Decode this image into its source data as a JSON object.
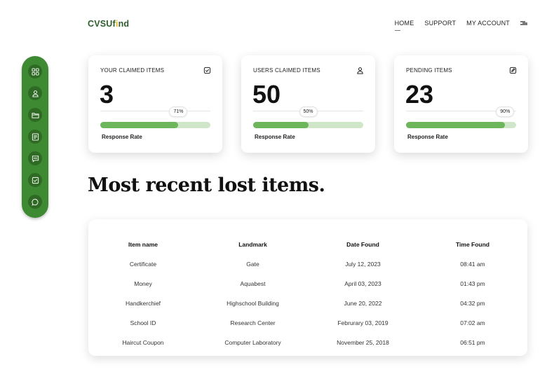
{
  "brand": {
    "part1": "CVSUf",
    "accent": "i",
    "part2": "nd"
  },
  "nav": {
    "items": [
      "HOME",
      "SUPPORT",
      "MY ACCOUNT"
    ]
  },
  "sidebar": {
    "icons": [
      "dashboard-icon",
      "user-icon",
      "folder-icon",
      "report-icon",
      "chat-bubble-icon",
      "checkbox-icon",
      "message-icon"
    ]
  },
  "cards": [
    {
      "label": "YOUR CLAIMED ITEMS",
      "value": "3",
      "rate": 71,
      "rate_label": "71%",
      "caption": "Response Rate",
      "icon": "check-square-icon"
    },
    {
      "label": "USERS CLAIMED ITEMS",
      "value": "50",
      "rate": 50,
      "rate_label": "50%",
      "caption": "Response Rate",
      "icon": "user-icon"
    },
    {
      "label": "PENDING ITEMS",
      "value": "23",
      "rate": 90,
      "rate_label": "90%",
      "caption": "Response Rate",
      "icon": "edit-icon"
    }
  ],
  "heading": "Most recent lost items.",
  "table": {
    "headers": [
      "Item name",
      "Landmark",
      "Date Found",
      "Time Found"
    ],
    "rows": [
      [
        "Certificate",
        "Gate",
        "July 12, 2023",
        "08:41 am"
      ],
      [
        "Money",
        "Aquabest",
        "April  03, 2023",
        "01:43 pm"
      ],
      [
        "Handkerchief",
        "Highschool Building",
        "June 20, 2022",
        "04:32 pm"
      ],
      [
        "School ID",
        "Research Center",
        "Februrary 03, 2019",
        "07:02 am"
      ],
      [
        "Haircut Coupon",
        "Computer Laboratory",
        "November 25, 2018",
        "06:51 pm"
      ]
    ]
  },
  "colors": {
    "brand": "#2f5d2e",
    "accent": "#e7b416",
    "sidebar": "#3e8a32",
    "bar_fill": "#6db65b",
    "bar_track": "#cfe6c8"
  }
}
